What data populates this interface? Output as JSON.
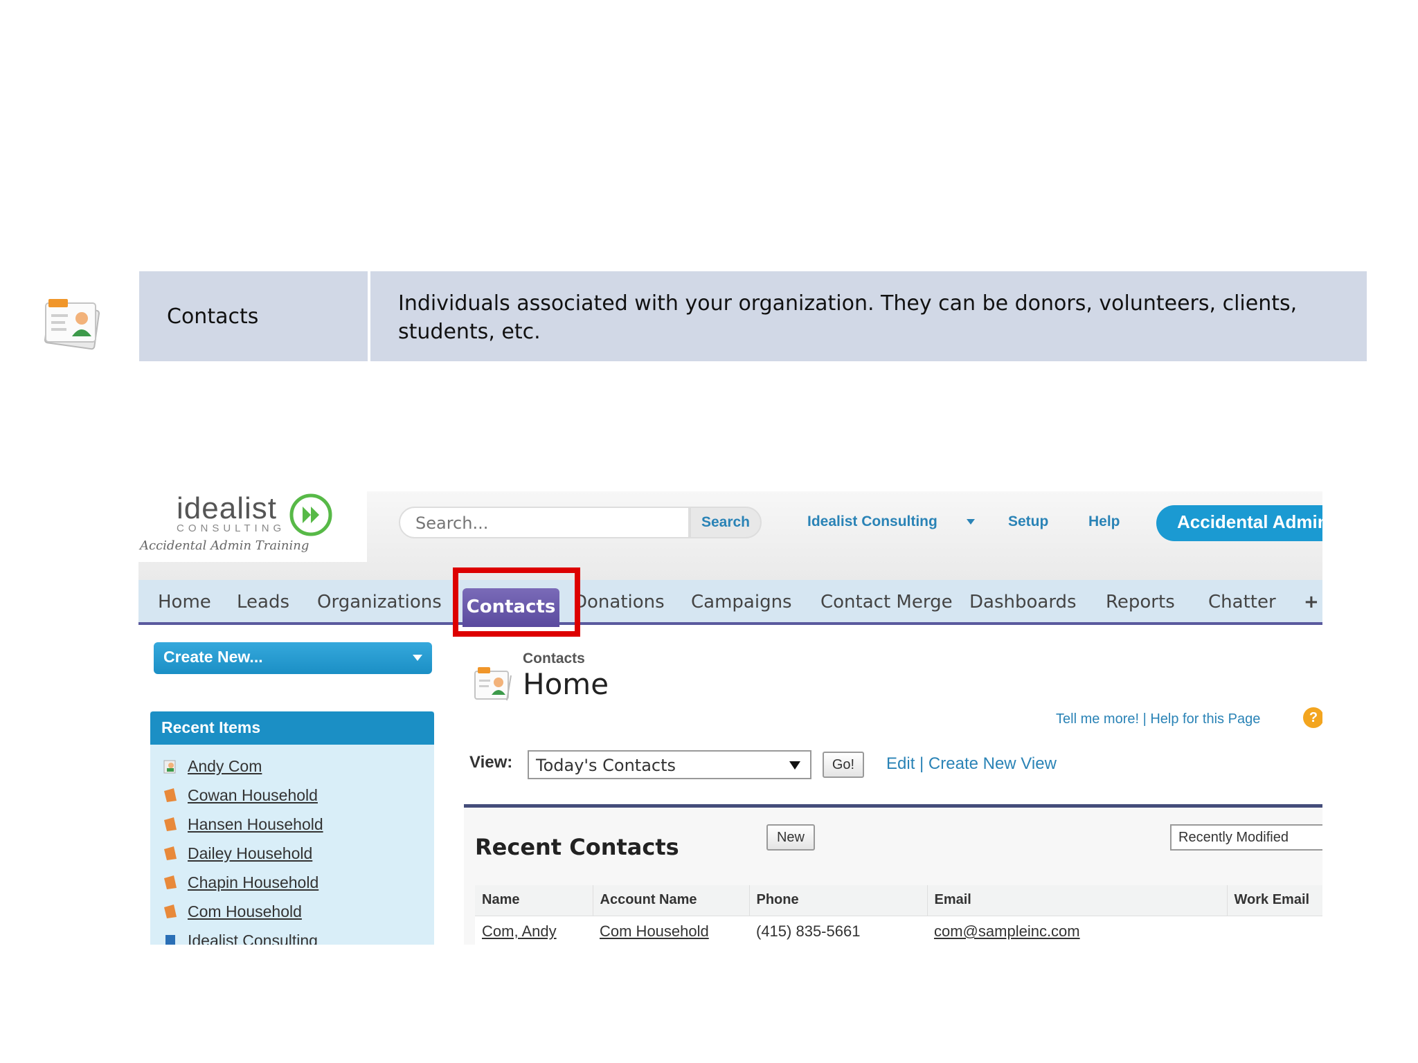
{
  "definition": {
    "term": "Contacts",
    "description": "Individuals associated with your organization. They can be donors, volunteers, clients, students, etc."
  },
  "header": {
    "logo_word": "idealist",
    "logo_sub": "CONSULTING",
    "logo_script": "Accidental Admin Training",
    "search_placeholder": "Search...",
    "search_button": "Search",
    "org_link": "Idealist Consulting",
    "setup_link": "Setup",
    "help_link": "Help",
    "app_button": "Accidental Admin"
  },
  "nav": {
    "tabs": [
      "Home",
      "Leads",
      "Organizations",
      "Contacts",
      "Donations",
      "Campaigns",
      "Contact Merge",
      "Dashboards",
      "Reports",
      "Chatter",
      "+"
    ],
    "active_tab": "Contacts"
  },
  "sidebar": {
    "create_new": "Create New...",
    "recent_items_title": "Recent Items",
    "recent_items": [
      "Andy Com",
      "Cowan Household",
      "Hansen Household",
      "Dailey Household",
      "Chapin Household",
      "Com Household",
      "Idealist Consulting"
    ]
  },
  "main": {
    "breadcrumb": "Contacts",
    "title": "Home",
    "tell_me_more": "Tell me more! | Help for this Page",
    "view_label": "View:",
    "view_selected": "Today's Contacts",
    "go_button": "Go!",
    "edit_links": "Edit | Create New View",
    "recent_contacts_title": "Recent Contacts",
    "new_button": "New",
    "sort_selected": "Recently Modified",
    "table": {
      "headers": [
        "Name",
        "Account Name",
        "Phone",
        "Email",
        "Work Email"
      ],
      "rows": [
        [
          "Com, Andy",
          "Com Household",
          "(415) 835-5661",
          "com@sampleinc.com",
          ""
        ]
      ]
    }
  },
  "colors": {
    "nav_active": "#5a4a9e",
    "link_blue": "#2a83b6",
    "highlight_red": "#dd0000",
    "definition_bg": "#d1d8e6"
  }
}
